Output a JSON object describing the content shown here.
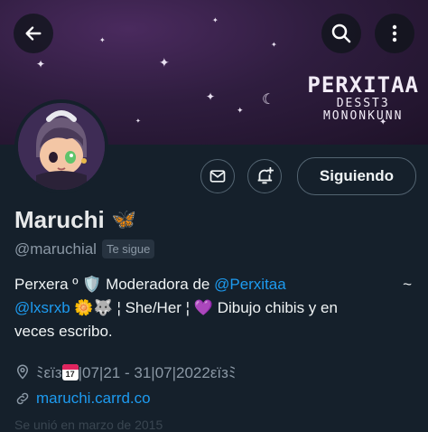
{
  "header": {
    "brand_title": "PERXITAA",
    "brand_line1": "DESST3",
    "brand_line2": "MONONKUNN",
    "back_icon": "arrow-left-icon",
    "search_icon": "search-icon",
    "more_icon": "more-vertical-icon"
  },
  "profile": {
    "name": "Maruchi",
    "name_emoji": "🦋",
    "handle": "@maruchial",
    "follows_you": "Te sigue",
    "follow_button": "Siguiendo",
    "bio": {
      "line1_text": "Perxera º 🛡️ Moderadora de ",
      "line1_mention": "@Perxitaa",
      "line1_tail": "~",
      "line2_mention": "@lxsrxb",
      "line2_text": "🌼🐺  ¦ She/Her ¦  💜 Dibujo chibis y en",
      "line3_text": "veces escribo."
    },
    "location_text": "ﾐεїз",
    "location_date": "|07|21 - 31|07|2022εїз",
    "location_tail": "ﾐ",
    "calendar_number": "17",
    "website": "maruchi.carrd.co",
    "faded_text": "Se unió en marzo de 2015"
  },
  "colors": {
    "background": "#15202b",
    "accent": "#1d9bf0",
    "secondary_text": "#8b98a5"
  }
}
